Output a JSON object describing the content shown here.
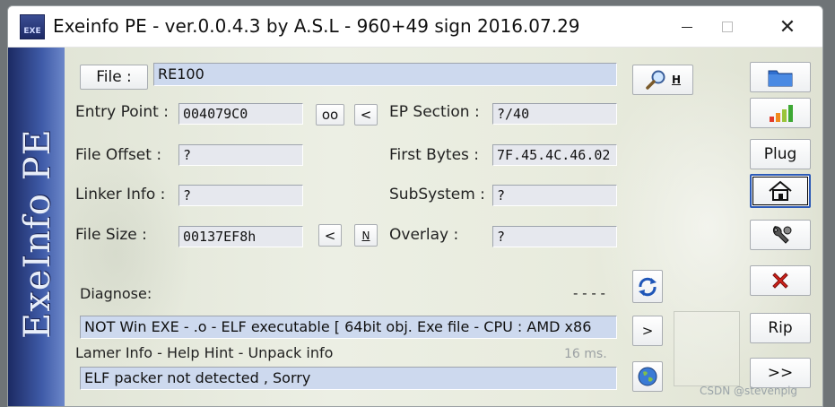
{
  "window": {
    "title": "Exeinfo PE - ver.0.0.4.3  by A.S.L -  960+49 sign  2016.07.29",
    "minimize_icon": "minimize-icon",
    "maximize_icon": "maximize-icon",
    "close_label": "✕"
  },
  "sidebar": {
    "label": "ExeInfo PE"
  },
  "file": {
    "button_label": "File :",
    "value": "RE100",
    "search_button": "H"
  },
  "fields": {
    "entry_point": {
      "label": "Entry Point :",
      "value": "004079C0"
    },
    "ep_section": {
      "label": "EP Section :",
      "value": "?/40"
    },
    "file_offset": {
      "label": "File Offset :",
      "value": "?"
    },
    "first_bytes": {
      "label": "First Bytes :",
      "value": "7F.45.4C.46.02"
    },
    "linker_info": {
      "label": "Linker Info :",
      "value": "?"
    },
    "subsystem": {
      "label": "SubSystem :",
      "value": "?"
    },
    "file_size": {
      "label": "File Size :",
      "value": "00137EF8h"
    },
    "overlay": {
      "label": "Overlay :",
      "value": "?"
    }
  },
  "buttons": {
    "oo": "oo",
    "lt_ep": "<",
    "lt_size": "<",
    "n_size": "N",
    "more": ">",
    "plug": "Plug",
    "rip": "Rip",
    "next": ">>"
  },
  "diagnose": {
    "label": "Diagnose:",
    "dashes": "- - - -",
    "result": "NOT Win EXE - .o - ELF executable [ 64bit obj. Exe file - CPU : AMD x86",
    "lamer_info": "Lamer Info - Help Hint - Unpack info",
    "time": "16 ms.",
    "packer": "ELF packer not detected , Sorry"
  },
  "watermark": "CSDN @stevenpig",
  "colors": {
    "accent": "#2d5bb7",
    "sidebar": "#3f5ba8",
    "field_blue": "#cdd9ee"
  }
}
